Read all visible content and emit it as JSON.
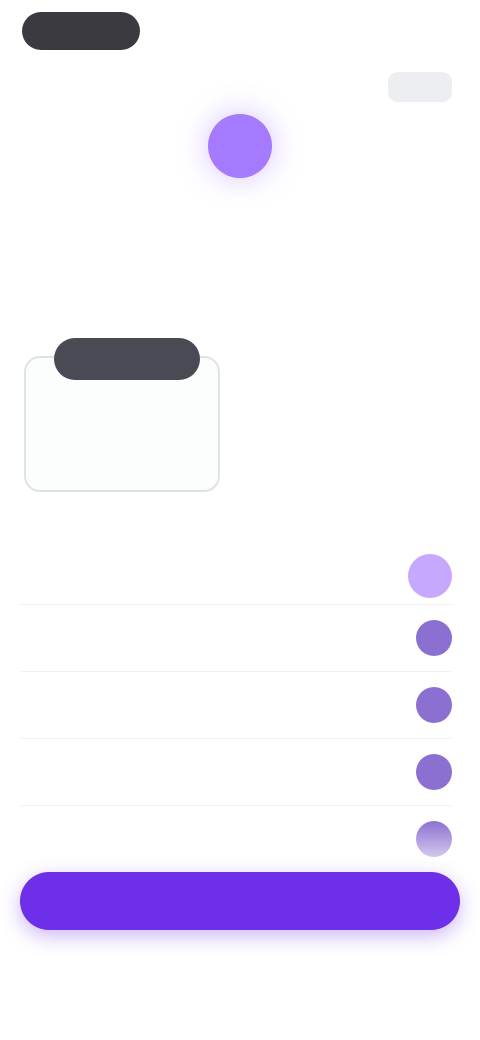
{
  "header": {
    "pill_label": "",
    "top_right_text": "",
    "top_right_button": ""
  },
  "hero": {
    "kicker": "",
    "title_line1": "",
    "title_accent": "",
    "title_rest": ""
  },
  "plans": {
    "selected": {
      "badge": "",
      "price": "",
      "savings": ""
    },
    "alternate": {
      "subtitle": "",
      "price": ""
    }
  },
  "features": {
    "header": {
      "name": "",
      "free": "",
      "pro": ""
    },
    "rows": [
      {
        "name": "",
        "free": "",
        "pro": ""
      },
      {
        "name": "",
        "free": "",
        "pro": ""
      },
      {
        "name": "",
        "free": "",
        "pro": ""
      },
      {
        "name": "",
        "free": "",
        "pro": ""
      }
    ]
  },
  "cta": {
    "label": ""
  },
  "footer": {
    "link_left": "",
    "link_right": "",
    "restore": ""
  },
  "colors": {
    "accent": "#6e2fe8",
    "accent_light": "#a47bff",
    "badge_dark": "#4a4a55",
    "savings_green": "#5cbf8a"
  },
  "icons": {
    "hero": "sparkle-icon"
  }
}
